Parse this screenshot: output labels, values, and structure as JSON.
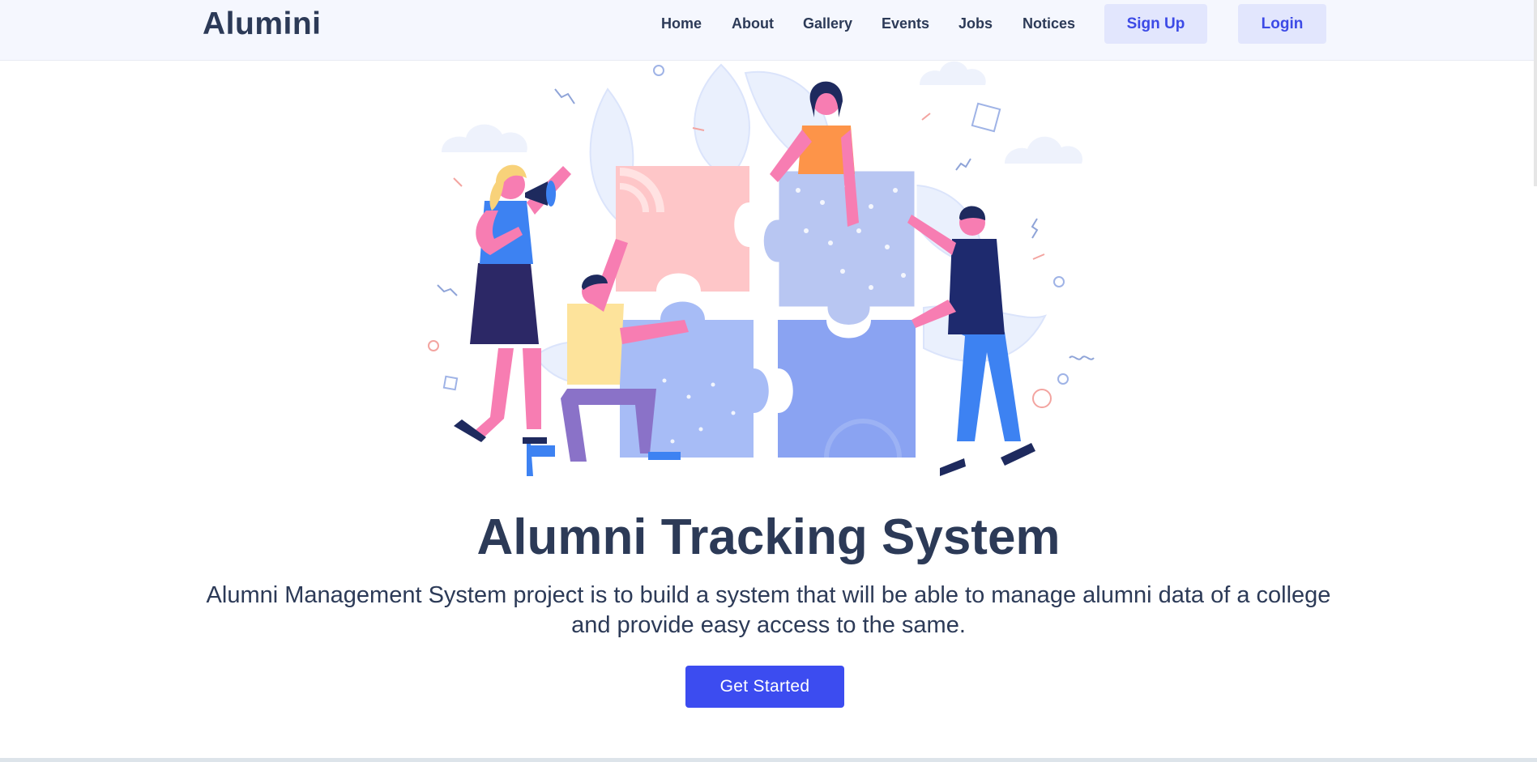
{
  "header": {
    "brand": "Alumini",
    "nav": [
      "Home",
      "About",
      "Gallery",
      "Events",
      "Jobs",
      "Notices"
    ],
    "signup_label": "Sign Up",
    "login_label": "Login"
  },
  "hero": {
    "title": "Alumni Tracking System",
    "description": "Alumni Management System project is to build a system that will be able to manage alumni data of a college and provide easy access to the same.",
    "cta_label": "Get Started"
  },
  "colors": {
    "brand_text": "#2c3a57",
    "accent": "#3c4cf0",
    "nav_button_bg": "#e2e6fd",
    "nav_bg": "#f5f7fe"
  }
}
